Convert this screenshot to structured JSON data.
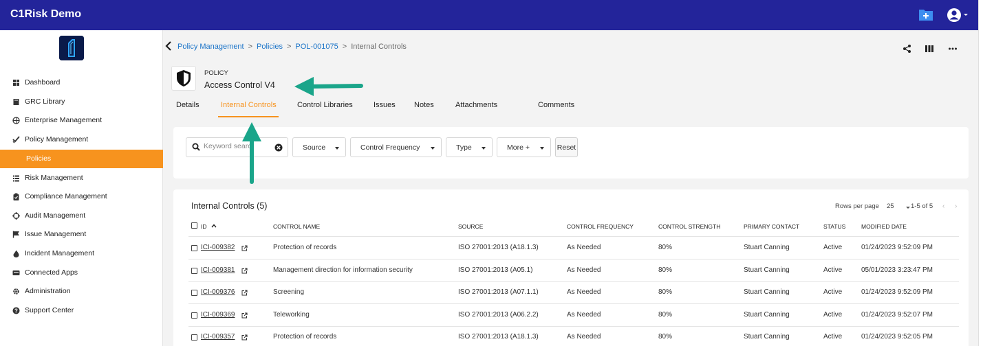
{
  "app": {
    "title": "C1Risk Demo"
  },
  "sidebar": {
    "items": [
      {
        "label": "Dashboard",
        "icon": "dashboard-icon"
      },
      {
        "label": "GRC Library",
        "icon": "book-icon"
      },
      {
        "label": "Enterprise Management",
        "icon": "globe-icon"
      },
      {
        "label": "Policy Management",
        "icon": "check-icon"
      },
      {
        "label": "Policies",
        "icon": "",
        "active": true
      },
      {
        "label": "Risk Management",
        "icon": "list-icon"
      },
      {
        "label": "Compliance Management",
        "icon": "clipboard-icon"
      },
      {
        "label": "Audit Management",
        "icon": "crosshair-icon"
      },
      {
        "label": "Issue Management",
        "icon": "flag-icon"
      },
      {
        "label": "Incident Management",
        "icon": "fire-icon"
      },
      {
        "label": "Connected Apps",
        "icon": "apps-icon"
      },
      {
        "label": "Administration",
        "icon": "gear-icon"
      },
      {
        "label": "Support Center",
        "icon": "help-icon"
      }
    ]
  },
  "breadcrumb": {
    "items": [
      "Policy Management",
      "Policies",
      "POL-001075"
    ],
    "current": "Internal Controls",
    "separator": ">"
  },
  "record": {
    "kicker": "POLICY",
    "title": "Access Control V4"
  },
  "tabs": [
    "Details",
    "Internal Controls",
    "Control Libraries",
    "Issues",
    "Notes",
    "Attachments",
    "Comments"
  ],
  "active_tab": "Internal Controls",
  "filters": {
    "search_placeholder": "Keyword search",
    "dropdowns": [
      "Source",
      "Control Frequency",
      "Type",
      "More +"
    ],
    "reset_label": "Reset"
  },
  "table": {
    "title": "Internal Controls (5)",
    "rows_per_page_label": "Rows per page",
    "rows_per_page": "25",
    "range": "1-5 of 5",
    "columns": [
      "ID",
      "CONTROL NAME",
      "SOURCE",
      "CONTROL FREQUENCY",
      "CONTROL STRENGTH",
      "PRIMARY CONTACT",
      "STATUS",
      "MODIFIED DATE"
    ],
    "rows": [
      [
        "ICI-009382",
        "Protection of records",
        "ISO 27001:2013 (A18.1.3)",
        "As Needed",
        "80%",
        "Stuart Canning",
        "Active",
        "01/24/2023 9:52:09 PM"
      ],
      [
        "ICI-009381",
        "Management direction for information security",
        "ISO 27001:2013 (A05.1)",
        "As Needed",
        "80%",
        "Stuart Canning",
        "Active",
        "05/01/2023 3:23:47 PM"
      ],
      [
        "ICI-009376",
        "Screening",
        "ISO 27001:2013 (A07.1.1)",
        "As Needed",
        "80%",
        "Stuart Canning",
        "Active",
        "01/24/2023 9:52:09 PM"
      ],
      [
        "ICI-009369",
        "Teleworking",
        "ISO 27001:2013 (A06.2.2)",
        "As Needed",
        "80%",
        "Stuart Canning",
        "Active",
        "01/24/2023 9:52:07 PM"
      ],
      [
        "ICI-009357",
        "Protection of records",
        "ISO 27001:2013 (A18.1.3)",
        "As Needed",
        "80%",
        "Stuart Canning",
        "Active",
        "01/24/2023 9:52:05 PM"
      ]
    ]
  },
  "colors": {
    "topbar": "#23249a",
    "accent": "#f7931e",
    "link": "#1a73c8",
    "annotation_arrow": "#1aa58a"
  }
}
